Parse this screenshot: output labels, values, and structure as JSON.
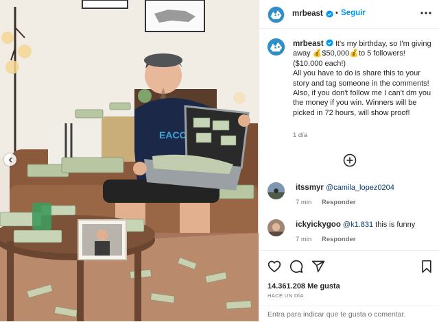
{
  "post": {
    "author": "mrbeast",
    "follow_label": "Seguir",
    "separator": "•",
    "caption_text": "It's my birthday, so I'm giving away 💰$50,000💰to 5 followers! ($10,000 each!)\nAll you have to do is share this to your story and tag someone in the comments! Also, if you don't follow me I can't dm you the money if you win. Winners will be picked in 72 hours, will show proof!",
    "caption_time": "1 día"
  },
  "comments": [
    {
      "user": "itssmyr",
      "mention": "@camila_lopez0204",
      "text": "",
      "time": "7 min",
      "reply_label": "Responder"
    },
    {
      "user": "ickyickygoo",
      "mention": "@k1.831",
      "text": " this is funny",
      "time": "7 min",
      "reply_label": "Responder"
    }
  ],
  "stats": {
    "likes": "14.361.208 Me gusta",
    "date": "HACE UN DÍA"
  },
  "comment_input": {
    "prefix": "Entra",
    "placeholder": "Entra para indicar que te gusta o comentar."
  },
  "icons": {
    "heart": "heart-icon",
    "comment": "comment-icon",
    "share": "share-icon",
    "save": "bookmark-icon",
    "more": "more-dots-icon",
    "load_more": "plus-circle-icon",
    "verified": "verified-badge-icon",
    "carousel_prev": "chevron-left-icon"
  },
  "colors": {
    "accent": "#0095f6",
    "verified": "#0095f6",
    "muted": "#737373",
    "text": "#262626",
    "avatar_bg": "#2e8fc9"
  }
}
